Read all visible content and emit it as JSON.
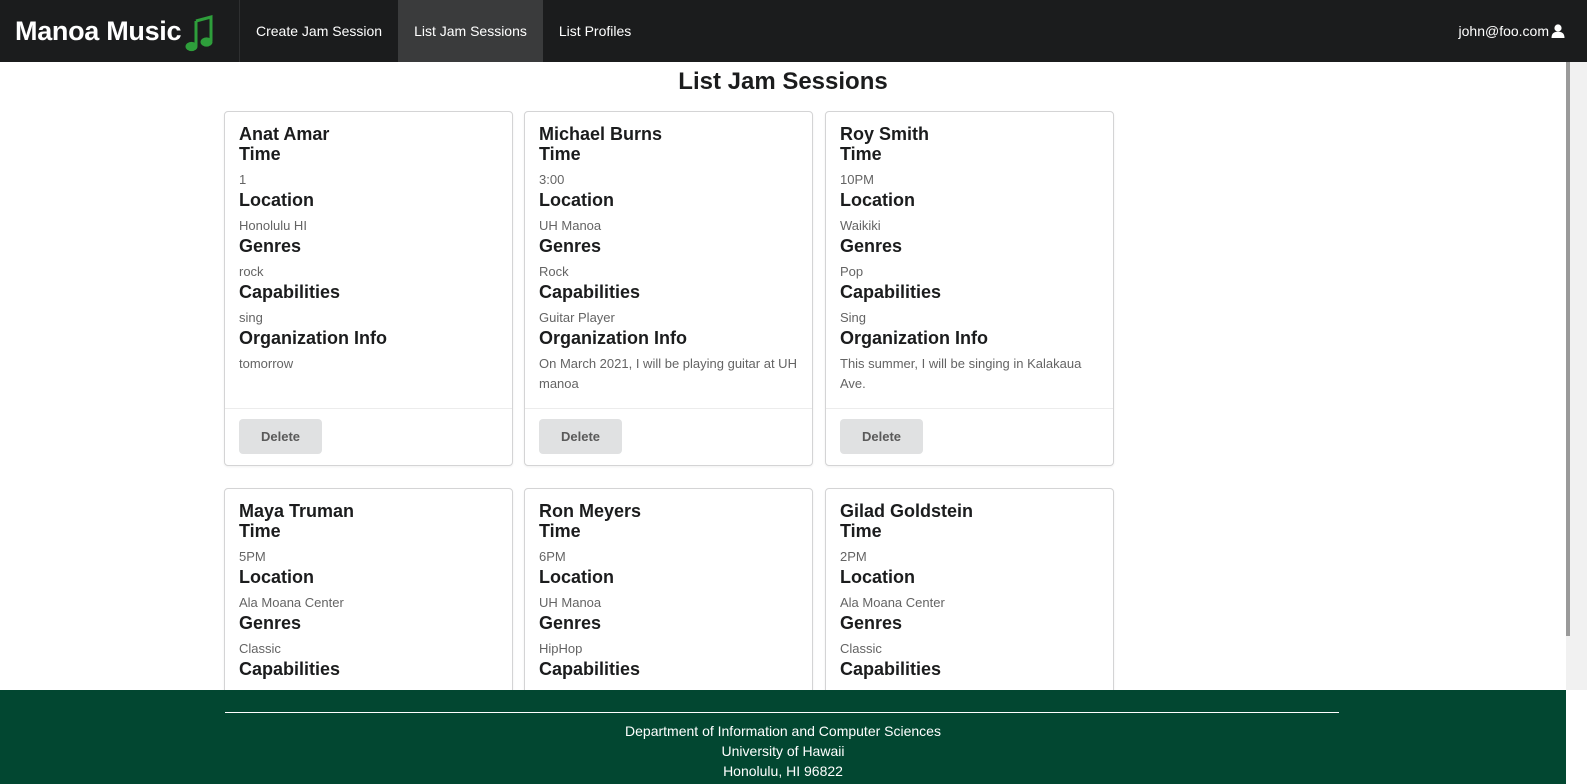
{
  "app": {
    "title": "Manoa Music",
    "brand_icon": "music-note-icon",
    "brand_icon_color": "#2e9e3b"
  },
  "nav": {
    "items": [
      {
        "label": "Create Jam Session",
        "active": false
      },
      {
        "label": "List Jam Sessions",
        "active": true
      },
      {
        "label": "List Profiles",
        "active": false
      }
    ],
    "user_email": "john@foo.com",
    "user_icon": "user-icon"
  },
  "page": {
    "title": "List Jam Sessions"
  },
  "labels": {
    "time": "Time",
    "location": "Location",
    "genres": "Genres",
    "capabilities": "Capabilities",
    "organization_info": "Organization Info",
    "delete": "Delete"
  },
  "sessions": [
    {
      "name": "Anat Amar",
      "time": "1",
      "location": "Honolulu HI",
      "genres": "rock",
      "capabilities": "sing",
      "organization_info": "tomorrow"
    },
    {
      "name": "Michael Burns",
      "time": "3:00",
      "location": "UH Manoa",
      "genres": "Rock",
      "capabilities": "Guitar Player",
      "organization_info": "On March 2021, I will be playing guitar at UH manoa"
    },
    {
      "name": "Roy Smith",
      "time": "10PM",
      "location": "Waikiki",
      "genres": "Pop",
      "capabilities": "Sing",
      "organization_info": "This summer, I will be singing in Kalakaua Ave."
    },
    {
      "name": "Maya Truman",
      "time": "5PM",
      "location": "Ala Moana Center",
      "genres": "Classic",
      "capabilities": ""
    },
    {
      "name": "Ron Meyers",
      "time": "6PM",
      "location": "UH Manoa",
      "genres": "HipHop",
      "capabilities": ""
    },
    {
      "name": "Gilad Goldstein",
      "time": "2PM",
      "location": "Ala Moana Center",
      "genres": "Classic",
      "capabilities": ""
    }
  ],
  "footer": {
    "lines": [
      "Department of Information and Computer Sciences",
      "University of Hawaii",
      "Honolulu, HI 96822"
    ],
    "background": "#024731"
  }
}
